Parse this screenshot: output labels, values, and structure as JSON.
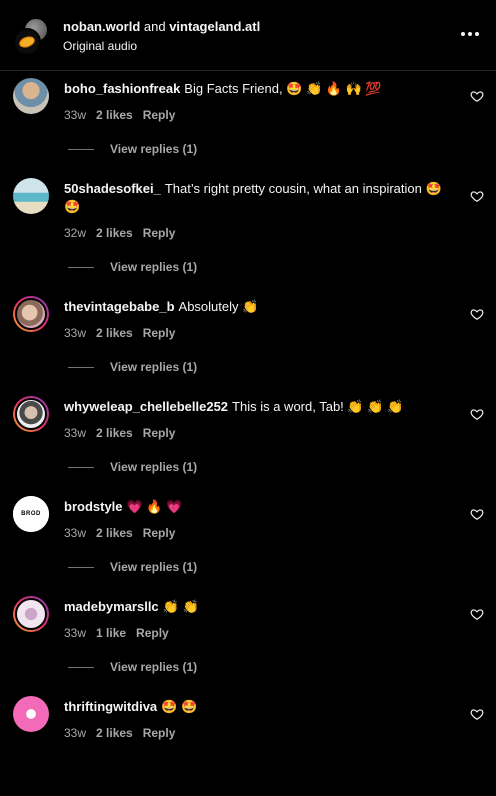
{
  "header": {
    "user1": "noban.world",
    "and_text": " and ",
    "user2": "vintageland.atl",
    "subtitle": "Original audio"
  },
  "comments": [
    {
      "username": "boho_fashionfreak",
      "text": "Big Facts Friend, 🤩 👏 🔥 🙌 💯",
      "time": "33w",
      "likes": "2 likes",
      "reply": "Reply",
      "view_replies": "View replies (1)"
    },
    {
      "username": "50shadesofkei_",
      "text": "That’s right pretty cousin, what an inspiration 🤩 🤩",
      "time": "32w",
      "likes": "2 likes",
      "reply": "Reply",
      "view_replies": "View replies (1)"
    },
    {
      "username": "thevintagebabe_b",
      "text": "Absolutely 👏",
      "time": "33w",
      "likes": "2 likes",
      "reply": "Reply",
      "view_replies": "View replies (1)"
    },
    {
      "username": "whyweleap_chellebelle252",
      "text": "This is a word, Tab! 👏 👏 👏",
      "time": "33w",
      "likes": "2 likes",
      "reply": "Reply",
      "view_replies": "View replies (1)"
    },
    {
      "username": "brodstyle",
      "text": "💗 🔥 💗",
      "time": "33w",
      "likes": "2 likes",
      "reply": "Reply",
      "view_replies": "View replies (1)"
    },
    {
      "username": "madebymarsllc",
      "text": "👏 👏",
      "time": "33w",
      "likes": "1 like",
      "reply": "Reply",
      "view_replies": "View replies (1)"
    },
    {
      "username": "thriftingwitdiva",
      "text": "🤩 🤩",
      "time": "33w",
      "likes": "2 likes",
      "reply": "Reply",
      "view_replies": ""
    }
  ],
  "avatar_logo_text": "BROD",
  "colors": {
    "background": "#000000",
    "text_primary": "#f5f5f5",
    "text_secondary": "#a8a8a8",
    "story_ring": [
      "#f9a825",
      "#e1306c",
      "#8a3ab9"
    ]
  }
}
